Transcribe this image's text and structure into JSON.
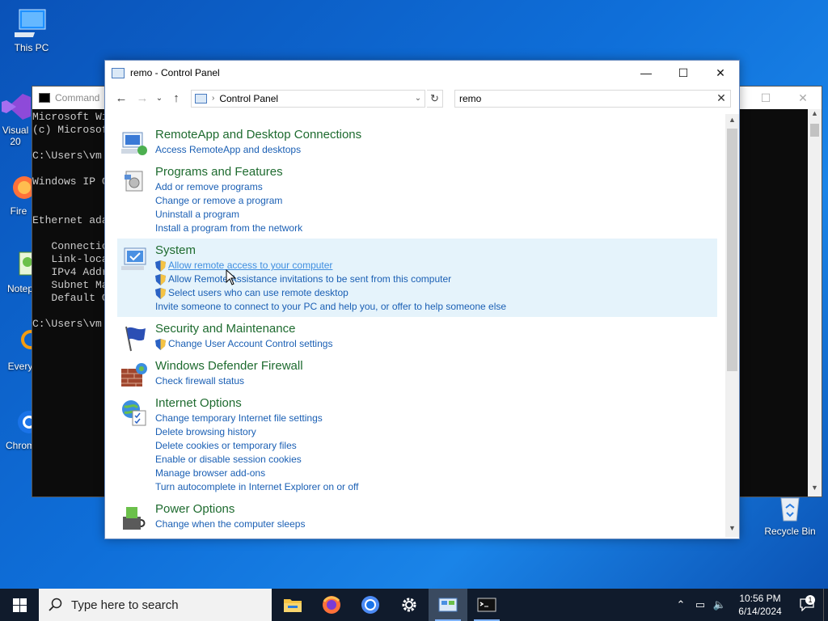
{
  "desktop": {
    "icons": [
      {
        "label": "This PC",
        "icon": "monitor-icon"
      },
      {
        "label": "Visual\n20",
        "icon": "visual-studio-icon"
      },
      {
        "label": "Fire",
        "icon": "firefox-icon"
      },
      {
        "label": "Notep",
        "icon": "notepad-icon"
      },
      {
        "label": "Every",
        "icon": "everything-icon"
      },
      {
        "label": "Chrom",
        "icon": "chrome-icon"
      }
    ],
    "recycle_bin": "Recycle Bin"
  },
  "cmd_window": {
    "title": "Command",
    "lines": [
      "Microsoft Wi",
      "(c) Microsof",
      "",
      "C:\\Users\\vm",
      "",
      "Windows IP C",
      "",
      "",
      "Ethernet ada",
      "",
      "   Connectio",
      "   Link-loca",
      "   IPv4 Addr",
      "   Subnet Ma",
      "   Default G",
      "",
      "C:\\Users\\vm"
    ]
  },
  "control_panel": {
    "title": "remo - Control Panel",
    "address": "Control Panel",
    "search_value": "remo",
    "groups": [
      {
        "title": "RemoteApp and Desktop Connections",
        "icon": "remoteapp-icon",
        "tasks": [
          {
            "label": "Access RemoteApp and desktops",
            "shield": false
          }
        ]
      },
      {
        "title": "Programs and Features",
        "icon": "programs-icon",
        "tasks": [
          {
            "label": "Add or remove programs",
            "shield": false
          },
          {
            "label": "Change or remove a program",
            "shield": false
          },
          {
            "label": "Uninstall a program",
            "shield": false
          },
          {
            "label": "Install a program from the network",
            "shield": false
          }
        ]
      },
      {
        "title": "System",
        "icon": "system-icon",
        "highlighted": true,
        "tasks": [
          {
            "label": "Allow remote access to your computer",
            "shield": true,
            "active": true
          },
          {
            "label": "Allow Remote Assistance invitations to be sent from this computer",
            "shield": true
          },
          {
            "label": "Select users who can use remote desktop",
            "shield": true
          },
          {
            "label": "Invite someone to connect to your PC and help you, or offer to help someone else",
            "shield": false
          }
        ]
      },
      {
        "title": "Security and Maintenance",
        "icon": "security-flag-icon",
        "tasks": [
          {
            "label": "Change User Account Control settings",
            "shield": true
          }
        ]
      },
      {
        "title": "Windows Defender Firewall",
        "icon": "firewall-icon",
        "tasks": [
          {
            "label": "Check firewall status",
            "shield": false
          }
        ]
      },
      {
        "title": "Internet Options",
        "icon": "internet-options-icon",
        "tasks": [
          {
            "label": "Change temporary Internet file settings",
            "shield": false
          },
          {
            "label": "Delete browsing history",
            "shield": false
          },
          {
            "label": "Delete cookies or temporary files",
            "shield": false
          },
          {
            "label": "Enable or disable session cookies",
            "shield": false
          },
          {
            "label": "Manage browser add-ons",
            "shield": false
          },
          {
            "label": "Turn autocomplete in Internet Explorer on or off",
            "shield": false
          }
        ]
      },
      {
        "title": "Power Options",
        "icon": "power-options-icon",
        "tasks": [
          {
            "label": "Change when the computer sleeps",
            "shield": false
          }
        ]
      }
    ]
  },
  "taskbar": {
    "search_placeholder": "Type here to search",
    "apps": [
      "file-explorer-icon",
      "firefox-icon",
      "chrome-icon",
      "settings-icon",
      "control-panel-icon",
      "command-prompt-icon"
    ],
    "time": "10:56 PM",
    "date": "6/14/2024",
    "notification_count": "1"
  }
}
